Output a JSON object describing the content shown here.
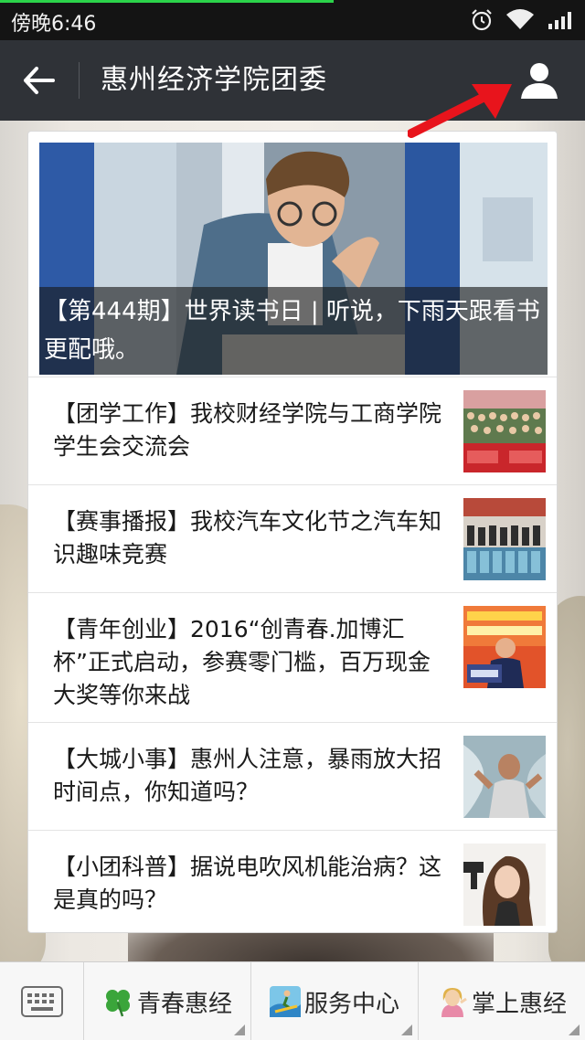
{
  "status_bar": {
    "time": "傍晚6:46"
  },
  "header": {
    "title": "惠州经济学院团委"
  },
  "articles": {
    "featured": {
      "title": "【第444期】世界读书日 | 听说，下雨天跟看书更配哦。"
    },
    "items": [
      {
        "title": "【团学工作】我校财经学院与工商学院学生会交流会"
      },
      {
        "title": "【赛事播报】我校汽车文化节之汽车知识趣味竞赛"
      },
      {
        "title": "【青年创业】2016“创青春.加博汇杯”正式启动，参赛零门槛，百万现金大奖等你来战"
      },
      {
        "title": "【大城小事】惠州人注意，暴雨放大招时间点，你知道吗？"
      },
      {
        "title": "【小团科普】据说电吹风机能治病？这是真的吗？"
      }
    ]
  },
  "bottom_menu": {
    "items": [
      {
        "label": "青春惠经",
        "icon": "four-leaf-clover-icon"
      },
      {
        "label": "服务中心",
        "icon": "surfer-icon"
      },
      {
        "label": "掌上惠经",
        "icon": "person-icon"
      }
    ]
  },
  "colors": {
    "nav_bg": "#2f3237",
    "status_bg": "#141414",
    "annotation_arrow": "#e8141c",
    "load_progress": "#2bd34a"
  },
  "load_progress": 0.57
}
